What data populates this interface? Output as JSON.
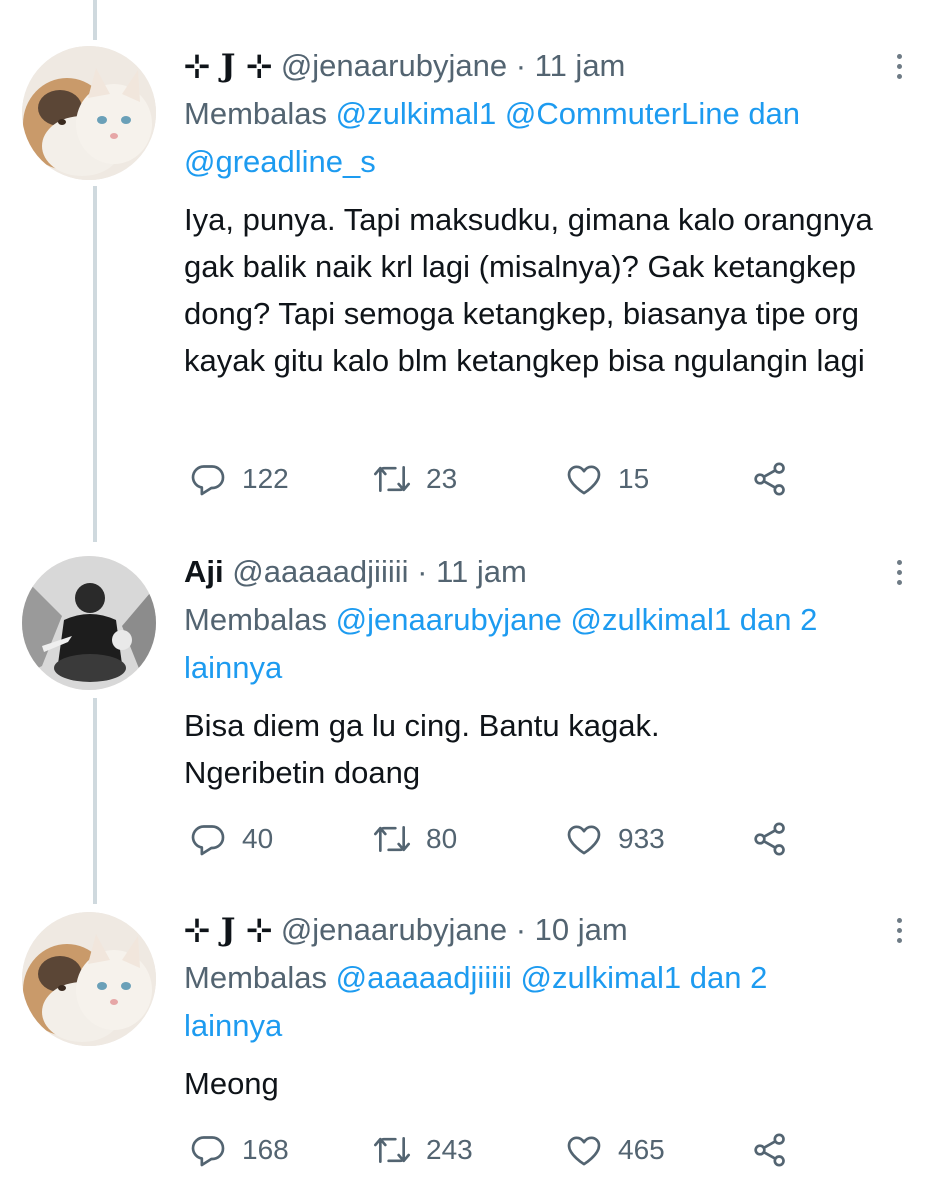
{
  "tweets": [
    {
      "display_name": "⊹ J ⊹",
      "handle": "@jenaarubyjane",
      "separator": "·",
      "time": "11 jam",
      "reply_prefix": "Membalas",
      "reply_mentions": "@zulkimal1 @CommuterLine",
      "reply_joiner": "dan",
      "reply_tail": "@greadline_s",
      "text": "Iya, punya. Tapi maksudku, gimana kalo orangnya gak balik naik krl lagi (misalnya)? Gak ketangkep dong? Tapi semoga ketangkep, biasanya tipe org kayak gitu kalo blm ketangkep bisa ngulangin lagi",
      "replies": "122",
      "retweets": "23",
      "likes": "15"
    },
    {
      "display_name": "Aji",
      "handle": "@aaaaadjiiiii",
      "separator": "·",
      "time": "11 jam",
      "reply_prefix": "Membalas",
      "reply_mentions": "@jenaarubyjane @zulkimal1 dan 2 lainnya",
      "text": "Bisa diem ga lu cing.  Bantu kagak. Ngeribetin doang",
      "replies": "40",
      "retweets": "80",
      "likes": "933"
    },
    {
      "display_name": "⊹ J ⊹",
      "handle": "@jenaarubyjane",
      "separator": "·",
      "time": "10 jam",
      "reply_prefix": "Membalas",
      "reply_mentions": "@aaaaadjiiiii @zulkimal1 dan 2 lainnya",
      "text": "Meong",
      "replies": "168",
      "retweets": "243",
      "likes": "465"
    }
  ],
  "icons": {
    "reply": "reply-icon",
    "retweet": "retweet-icon",
    "like": "like-icon",
    "share": "share-icon",
    "more": "more-icon"
  },
  "colors": {
    "accent": "#1d9bf0",
    "secondary_text": "#536471",
    "primary_text": "#0f1419",
    "thread_line": "#cfd9de"
  }
}
